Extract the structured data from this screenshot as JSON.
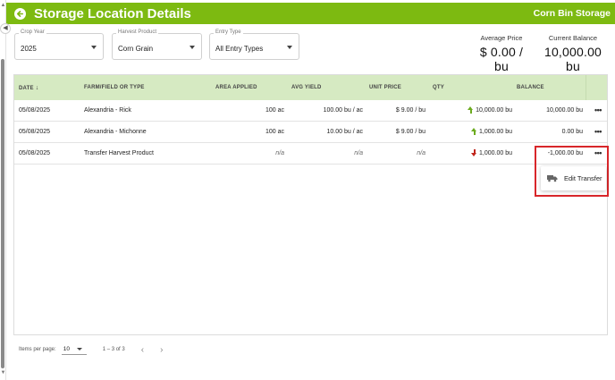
{
  "header": {
    "title": "Storage Location Details",
    "location_name": "Corn Bin Storage"
  },
  "filters": {
    "crop_year": {
      "label": "Crop Year",
      "value": "2025"
    },
    "harvest_product": {
      "label": "Harvest Product",
      "value": "Corn Grain"
    },
    "entry_type": {
      "label": "Entry Type",
      "value": "All Entry Types"
    }
  },
  "stats": {
    "average_price": {
      "label": "Average Price",
      "value": "$ 0.00 / bu"
    },
    "current_balance": {
      "label": "Current Balance",
      "value": "10,000.00 bu"
    }
  },
  "table": {
    "columns": [
      "DATE",
      "FARM/FIELD OR TYPE",
      "AREA APPLIED",
      "AVG YIELD",
      "UNIT PRICE",
      "QTY",
      "BALANCE"
    ],
    "sort_icon": "arrow-down-icon",
    "rows": [
      {
        "date": "05/08/2025",
        "field": "Alexandria - Rick",
        "area": "100 ac",
        "avg_yield": "100.00 bu / ac",
        "unit_price": "$ 9.00 / bu",
        "qty_direction": "up",
        "qty": "10,000.00 bu",
        "balance": "10,000.00 bu"
      },
      {
        "date": "05/08/2025",
        "field": "Alexandria - Michonne",
        "area": "100 ac",
        "avg_yield": "10.00 bu / ac",
        "unit_price": "$ 9.00 / bu",
        "qty_direction": "up",
        "qty": "1,000.00 bu",
        "balance": "0.00 bu"
      },
      {
        "date": "05/08/2025",
        "field": "Transfer Harvest Product",
        "area": "n/a",
        "avg_yield": "n/a",
        "unit_price": "n/a",
        "qty_direction": "down",
        "qty": "1,000.00 bu",
        "balance": "-1,000.00 bu"
      }
    ]
  },
  "row_menu": {
    "items": [
      {
        "label": "Edit Transfer",
        "icon": "truck-icon"
      }
    ]
  },
  "pagination": {
    "items_per_page_label": "Items per page:",
    "page_size": "10",
    "range": "1 – 3 of 3",
    "prev": "‹",
    "next": "›"
  },
  "colors": {
    "header_green": "#7dba11",
    "table_header_bg": "#d6eac2",
    "qty_up": "#6cab1f",
    "qty_down": "#c0251b",
    "highlight": "#d8262a"
  }
}
